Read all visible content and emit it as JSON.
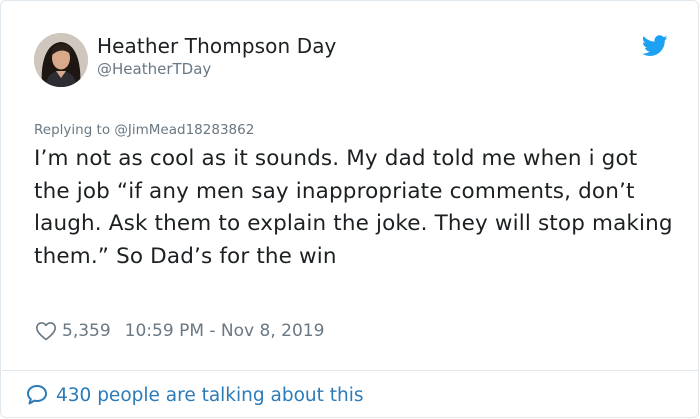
{
  "tweet": {
    "author_name": "Heather Thompson Day",
    "author_handle": "@HeatherTDay",
    "reply_prefix": "Replying to",
    "reply_to": "@JimMead18283862",
    "text": "I’m not as cool as it sounds. My dad told me when i got the job “if any men say inappropriate comments, don’t laugh. Ask them to explain the joke. They will stop making them.” So Dad’s for the win",
    "likes": "5,359",
    "timestamp": "10:59 PM - Nov 8, 2019",
    "talking": "430 people are talking about this"
  },
  "icons": {
    "platform": "twitter-bird-icon",
    "like": "heart-icon",
    "conversation": "speech-bubble-icon"
  },
  "colors": {
    "text": "#1c2022",
    "secondary": "#697882",
    "link": "#2b7bb9",
    "twitter_blue": "#1da1f2",
    "border": "#e1e8ed"
  }
}
